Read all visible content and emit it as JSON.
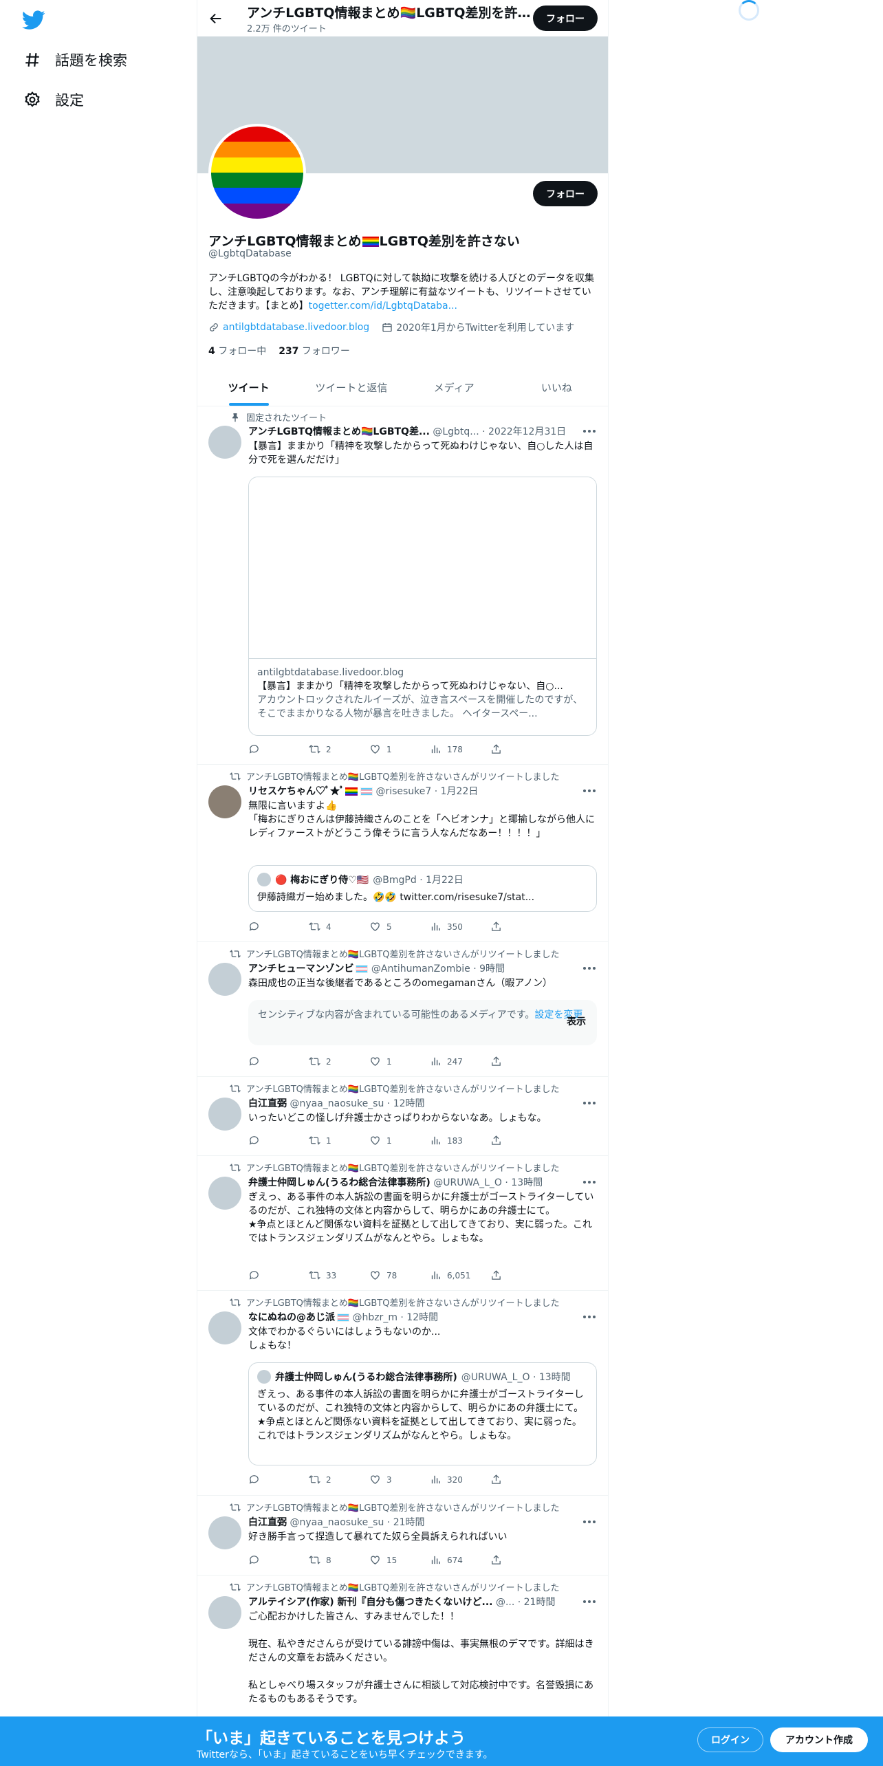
{
  "nav": {
    "explore_label": "話題を検索",
    "settings_label": "設定"
  },
  "header": {
    "name": "アンチLGBTQ情報まとめ🏳️‍🌈LGBTQ差別を許さない",
    "tweet_count": "2.2万 件のツイート",
    "follow_label": "フォロー"
  },
  "profile": {
    "name_part1": "アンチLGBTQ情報まとめ",
    "name_part2": "LGBTQ差別を許さない",
    "handle": "@LgbtqDatabase",
    "bio": "アンチLGBTQの今がわかる！ LGBTQに対して執拗に攻撃を続ける人びとのデータを収集し、注意喚起しております。なお、アンチ理解に有益なツイートも、リツイートさせていただきます。【まとめ】",
    "bio_link": "togetter.com/id/LgbtqDataba...",
    "website": "antilgbtdatabase.livedoor.blog",
    "joined": "2020年1月からTwitterを利用しています",
    "following_count": "4",
    "following_label": "フォロー中",
    "followers_count": "237",
    "followers_label": "フォロワー",
    "follow_label": "フォロー"
  },
  "tabs": [
    "ツイート",
    "ツイートと返信",
    "メディア",
    "いいね"
  ],
  "retweet_context": "アンチLGBTQ情報まとめ🏳️‍🌈LGBTQ差別を許さないさんがリツイートしました",
  "pinned_label": "固定されたツイート",
  "tweets": [
    {
      "name": "アンチLGBTQ情報まとめ🏳️‍🌈LGBTQ差...",
      "meta": "@Lgbtq... · 2022年12月31日",
      "text": "【暴言】ままかり「精神を攻撃したからって死ぬわけじゃない、自○した人は自分で死を選んだだけ」",
      "card_domain": "antilgbtdatabase.livedoor.blog",
      "card_title": "【暴言】ままかり「精神を攻撃したからって死ぬわけじゃない、自○...",
      "card_desc": "アカウントロックされたルイーズが、泣き言スペースを開催したのですが、そこでままかりなる人物が暴言を吐きました。 ヘイタースペー...",
      "replies": "",
      "retweets": "2",
      "likes": "1",
      "views": "178"
    },
    {
      "name": "リセスケちゃん♡ﾟ★ﾟ",
      "meta": "@risesuke7 · 1月22日",
      "text": "無限に言いますよ👍\n「梅おにぎりさんは伊藤詩織さんのことを「ヘビオンナ」と揶揄しながら他人にレディファーストがどうこう偉そうに言う人なんだなあー！！！！」",
      "quote_name": "🔴 梅おにぎり侍♡🇺🇸",
      "quote_meta": "@BmgPd · 1月22日",
      "quote_text": "伊藤詩織ガー始めました。🤣🤣 twitter.com/risesuke7/stat...",
      "replies": "",
      "retweets": "4",
      "likes": "5",
      "views": "350"
    },
    {
      "name": "アンチヒューマンゾンビ",
      "meta": "@AntihumanZombie · 9時間",
      "text": "森田成也の正当な後継者であるところのomegamanさん（暇アノン）",
      "sensitive_text": "センシティブな内容が含まれている可能性のあるメディアです。",
      "sensitive_link": "設定を変更",
      "sensitive_show": "表示",
      "replies": "",
      "retweets": "2",
      "likes": "1",
      "views": "247"
    },
    {
      "name": "白江直弼",
      "meta": "@nyaa_naosuke_su · 12時間",
      "text": "いったいどこの怪しげ弁護士かさっぱりわからないなあ。しょもな。",
      "replies": "",
      "retweets": "1",
      "likes": "1",
      "views": "183"
    },
    {
      "name": "弁護士仲岡しゅん(うるわ総合法律事務所)",
      "meta": "@URUWA_L_O · 13時間",
      "text": "ぎえっ、ある事件の本人訴訟の書面を明らかに弁護士がゴーストライターしているのだが、これ独特の文体と内容からして、明らかにあの弁護士にて。\n★争点とほとんど関係ない資料を証拠として出してきており、実に弱った。これではトランスジェンダリズムがなんとやら。しょもな。",
      "replies": "",
      "retweets": "33",
      "likes": "78",
      "views": "6,051"
    },
    {
      "name": "なにぬねの@あじ派",
      "meta": "@hbzr_m · 12時間",
      "text": "文体でわかるぐらいにはしょうもないのか...\nしょもな！",
      "quote_name": "弁護士仲岡しゅん(うるわ総合法律事務所)",
      "quote_meta": "@URUWA_L_O · 13時間",
      "quote_text": "ぎえっ、ある事件の本人訴訟の書面を明らかに弁護士がゴーストライターしているのだが、これ独特の文体と内容からして、明らかにあの弁護士にて。\n★争点とほとんど関係ない資料を証拠として出してきており、実に弱った。これではトランスジェンダリズムがなんとやら。しょもな。",
      "replies": "",
      "retweets": "2",
      "likes": "3",
      "views": "320"
    },
    {
      "name": "白江直弼",
      "meta": "@nyaa_naosuke_su · 21時間",
      "text": "好き勝手言って捏造して暴れてた奴ら全員訴えられればいい",
      "replies": "",
      "retweets": "8",
      "likes": "15",
      "views": "674"
    },
    {
      "name": "アルテイシア(作家) 新刊『自分も傷つきたくないけど...",
      "meta": "@... · 21時間",
      "text": "ご心配おかけした皆さん、すみませんでした！！\n\n現在、私やきださんらが受けている誹謗中傷は、事実無根のデマです。詳細はきださんの文章をお読みください。\n\n私としゃべり場スタッフが弁護士さんに相談して対応検討中です。名誉毀損にあたるものもあるそうです。"
    }
  ],
  "bottom_bar": {
    "title": "「いま」起きていることを見つけよう",
    "subtitle": "Twitterなら、「いま」起きていることをいち早くチェックできます。",
    "login_label": "ログイン",
    "signup_label": "アカウント作成"
  },
  "colors": {
    "accent": "#1d9bf0",
    "text": "#0f1419",
    "secondary": "#536471",
    "border": "#eff3f4",
    "banner": "#cfd9de"
  }
}
